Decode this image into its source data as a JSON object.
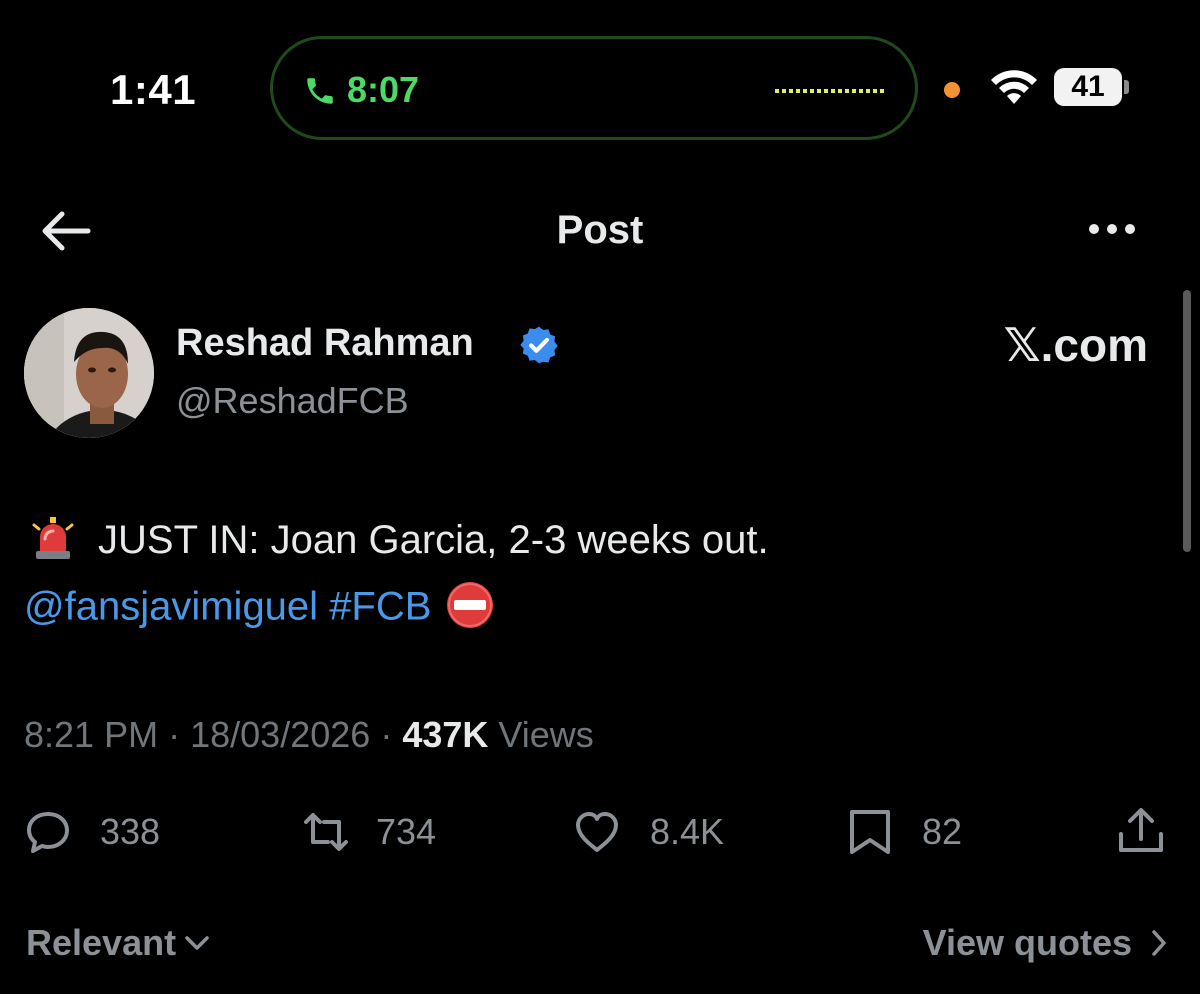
{
  "status_bar": {
    "time": "1:41",
    "call_duration": "8:07",
    "battery_level": "41",
    "call_color": "#4cd964",
    "privacy_dot_color": "#f29333"
  },
  "header": {
    "title": "Post",
    "back_icon": "arrow-left-icon",
    "more_icon": "more-horizontal-icon"
  },
  "author": {
    "name": "Reshad Rahman",
    "handle": "@ReshadFCB",
    "verified": true,
    "verified_color": "#3b8ded"
  },
  "watermark": "𝕏.com",
  "tweet": {
    "emoji_start": "siren-emoji",
    "text": "JUST IN: Joan Garcia, 2-3 weeks out.",
    "mention": "@fansjavimiguel",
    "hashtag": "#FCB",
    "emoji_end": "no-entry-emoji",
    "link_color": "#4a99e9"
  },
  "meta": {
    "time": "8:21 PM",
    "separator": "·",
    "date": "18/03/2026",
    "views_count": "437K",
    "views_label": "Views"
  },
  "actions": {
    "replies": "338",
    "reposts": "734",
    "likes": "8.4K",
    "bookmarks": "82"
  },
  "footer": {
    "sort_label": "Relevant",
    "view_quotes_label": "View quotes"
  }
}
